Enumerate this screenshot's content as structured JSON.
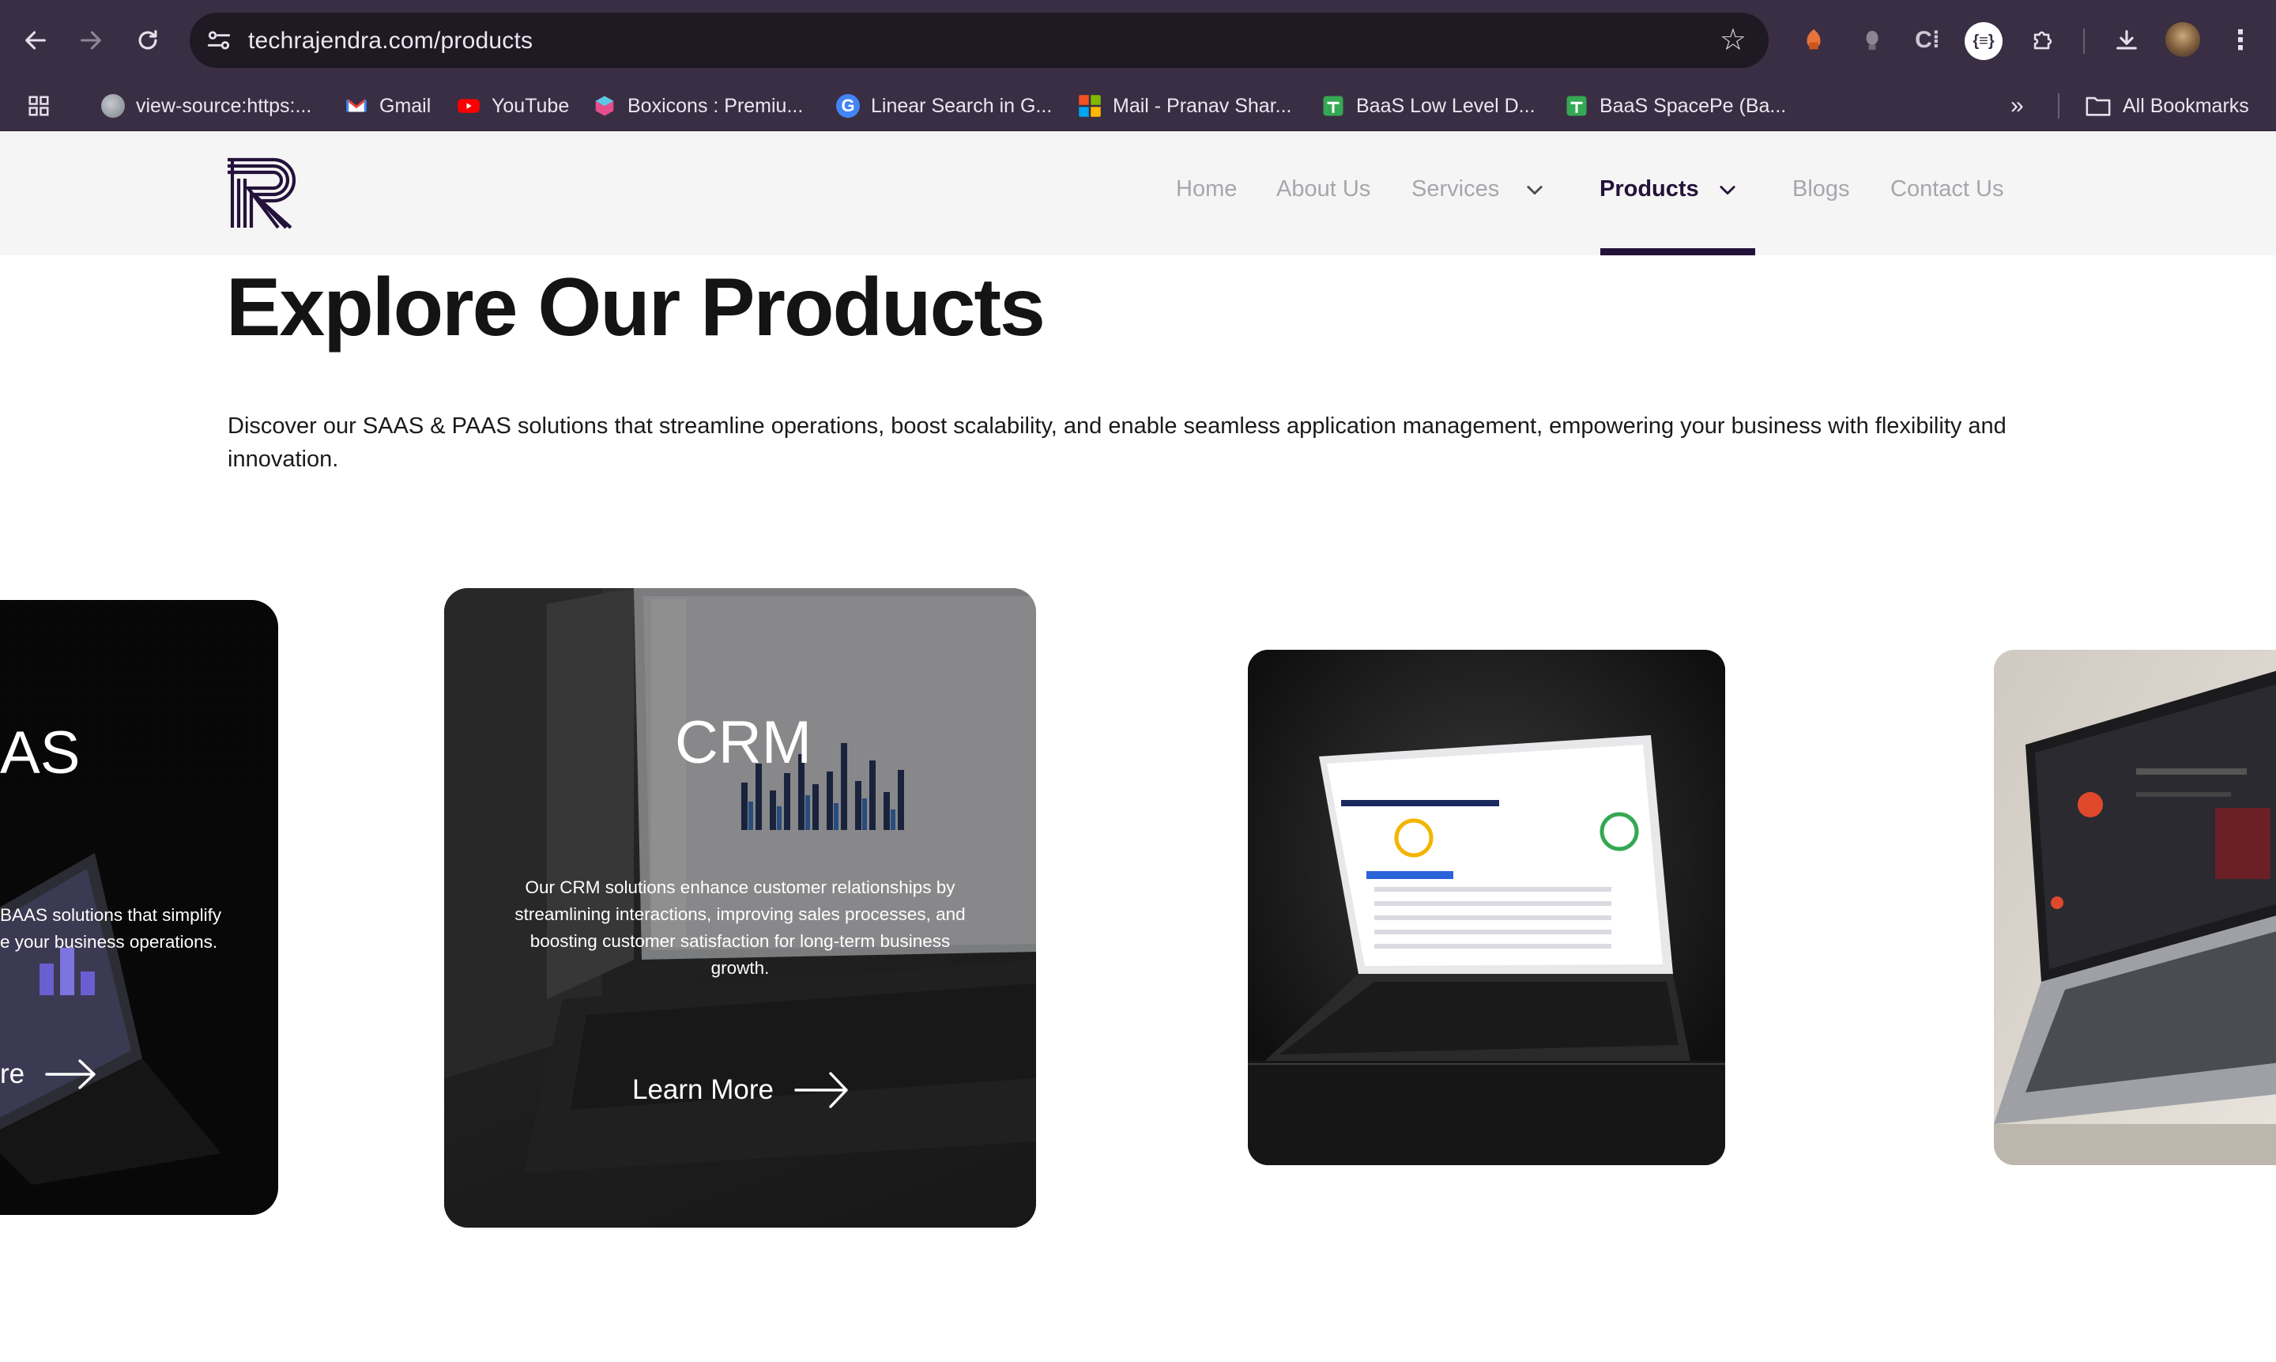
{
  "browser": {
    "url": "techrajendra.com/products",
    "bookmarks": [
      {
        "label": "view-source:https:...",
        "color": "#9aa0a6"
      },
      {
        "label": "Gmail",
        "color": "#ea4335"
      },
      {
        "label": "YouTube",
        "color": "#ff0000"
      },
      {
        "label": "Boxicons : Premiu...",
        "color": "#e44f8b"
      },
      {
        "label": "Linear Search in G...",
        "color": "#4285f4"
      },
      {
        "label": "Mail - Pranav Shar...",
        "color": "#f25022"
      },
      {
        "label": "BaaS Low Level D...",
        "color": "#34a853"
      },
      {
        "label": "BaaS SpacePe (Ba...",
        "color": "#34a853"
      }
    ],
    "all_bookmarks": "All Bookmarks"
  },
  "nav": {
    "items": [
      {
        "label": "Home"
      },
      {
        "label": "About Us"
      },
      {
        "label": "Services"
      },
      {
        "label": "Products"
      },
      {
        "label": "Blogs"
      },
      {
        "label": "Contact Us"
      }
    ],
    "active": "Products"
  },
  "page": {
    "title": "Explore Our Products",
    "intro": "Discover our SAAS & PAAS solutions that streamline operations, boost scalability, and enable seamless application management, empowering your business with flexibility and innovation."
  },
  "cards": [
    {
      "title": "AS",
      "desc_line1": "BAAS solutions that simplify",
      "desc_line2": "e your business operations.",
      "cta": "re"
    },
    {
      "title": "CRM",
      "desc": "Our CRM solutions enhance customer relationships by streamlining interactions, improving sales processes, and boosting customer satisfaction for long-term business growth.",
      "cta": "Learn More"
    }
  ],
  "colors": {
    "chrome": "#3a2e44",
    "brand": "#24123a",
    "nav_inactive": "#a8a5ab"
  }
}
